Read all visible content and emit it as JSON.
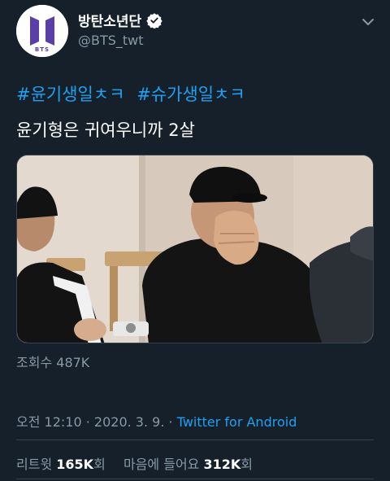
{
  "author": {
    "display_name": "방탄소년단",
    "handle": "@BTS_twt",
    "avatar_label": "BTS"
  },
  "tweet": {
    "hashtags": [
      "#윤기생일ㅊㅋ",
      "#슈가생일ㅊㅋ"
    ],
    "text": "윤기형은 귀여우니까 2살"
  },
  "views": {
    "label": "조회수",
    "count": "487K"
  },
  "meta": {
    "time": "오전 12:10",
    "date": "2020. 3. 9.",
    "source": "Twitter for Android"
  },
  "stats": {
    "retweets_label": "리트윗",
    "retweets_count": "165K",
    "retweets_unit": "회",
    "likes_label": "마음에 들어요",
    "likes_count": "312K",
    "likes_unit": "회"
  },
  "colors": {
    "background": "#15202b",
    "link": "#1da1f2",
    "secondary_text": "#8899a6",
    "divider": "#38444d",
    "brand_purple": "#5b3fa8"
  },
  "icons": [
    "verified-badge-icon",
    "chevron-down-icon",
    "bts-logo-icon"
  ]
}
